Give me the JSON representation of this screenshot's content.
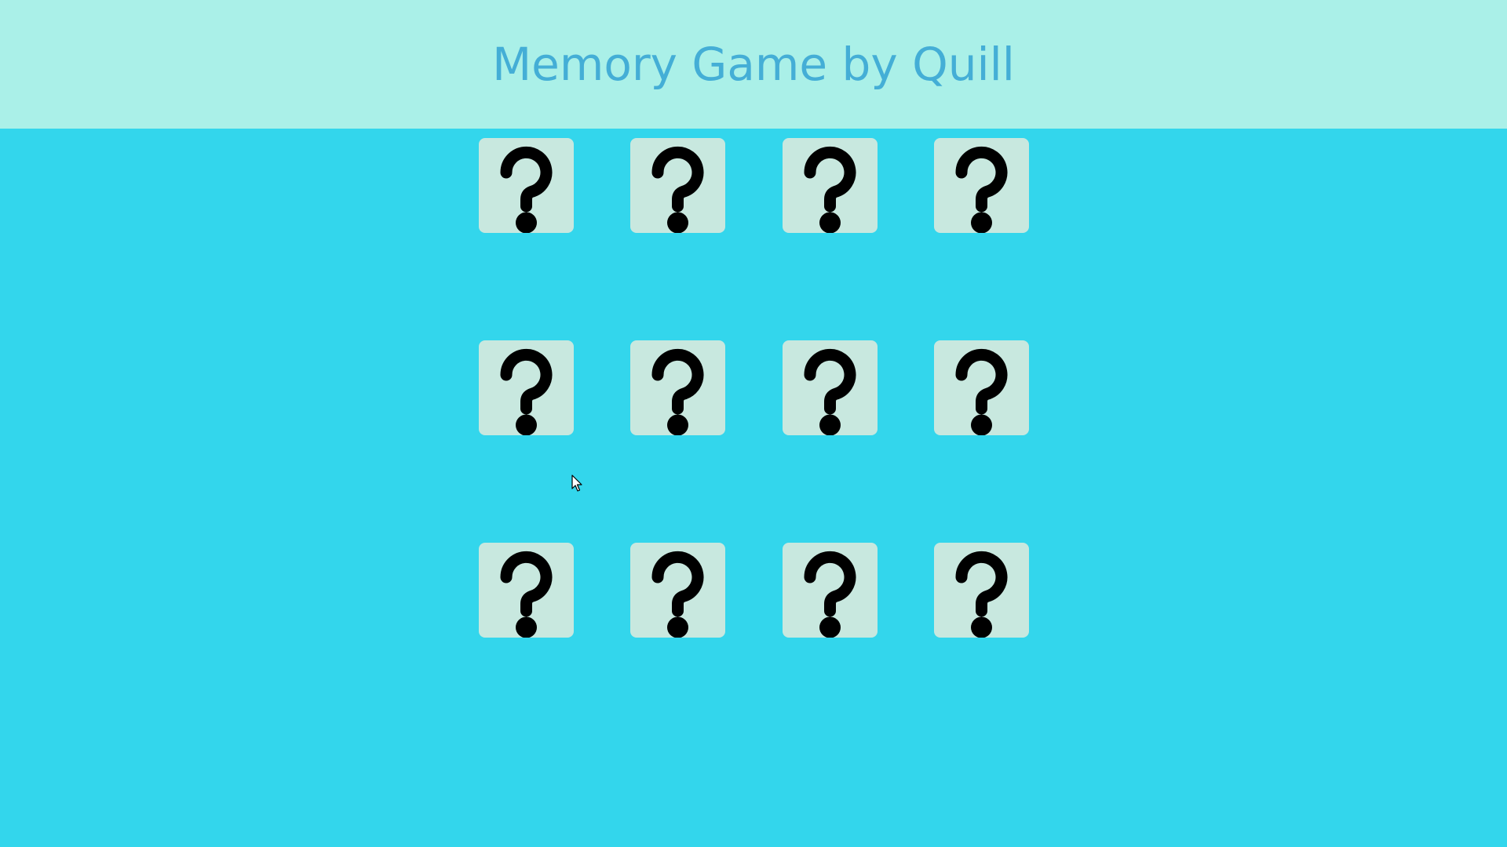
{
  "header": {
    "title": "Memory Game by Quill"
  },
  "board": {
    "rows": 3,
    "columns": 4,
    "cards": [
      {
        "face": "?",
        "state": "hidden"
      },
      {
        "face": "?",
        "state": "hidden"
      },
      {
        "face": "?",
        "state": "hidden"
      },
      {
        "face": "?",
        "state": "hidden"
      },
      {
        "face": "?",
        "state": "hidden"
      },
      {
        "face": "?",
        "state": "hidden"
      },
      {
        "face": "?",
        "state": "hidden"
      },
      {
        "face": "?",
        "state": "hidden"
      },
      {
        "face": "?",
        "state": "hidden"
      },
      {
        "face": "?",
        "state": "hidden"
      },
      {
        "face": "?",
        "state": "hidden"
      },
      {
        "face": "?",
        "state": "hidden"
      }
    ]
  },
  "icons": {
    "card_back": "question-mark-icon",
    "cursor": "mouse-pointer-icon"
  },
  "colors": {
    "background": "#33d6ec",
    "header_background": "#aaf0e8",
    "title_color": "#44aed6",
    "card_background": "#c8e8df",
    "card_symbol": "#000000"
  }
}
